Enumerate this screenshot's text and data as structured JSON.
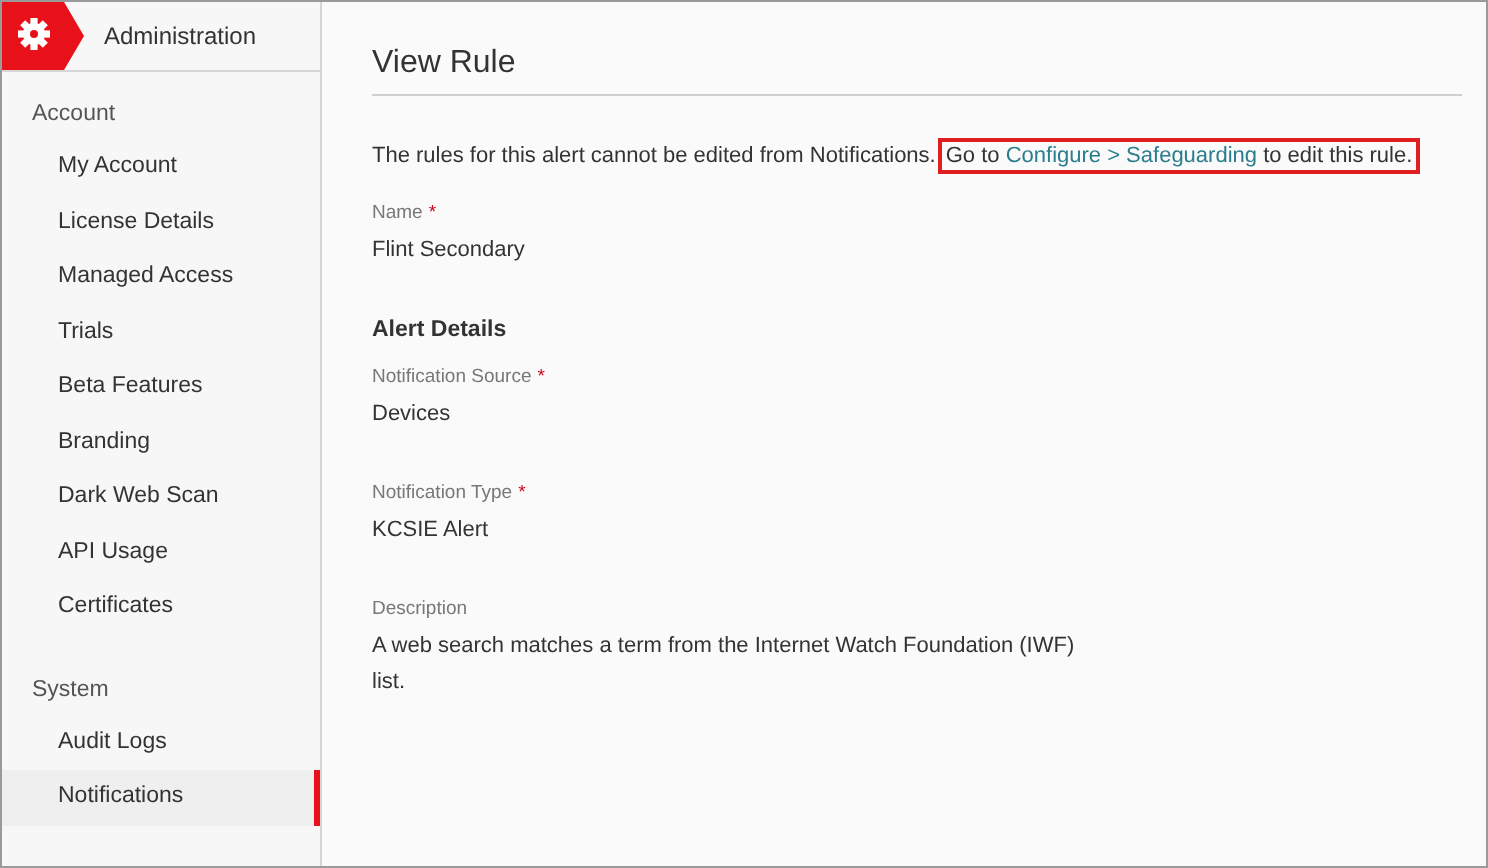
{
  "sidebar": {
    "header": "Administration",
    "groups": [
      {
        "title": "Account",
        "items": [
          {
            "label": "My Account",
            "selected": false
          },
          {
            "label": "License Details",
            "selected": false
          },
          {
            "label": "Managed Access",
            "selected": false
          },
          {
            "label": "Trials",
            "selected": false
          },
          {
            "label": "Beta Features",
            "selected": false
          },
          {
            "label": "Branding",
            "selected": false
          },
          {
            "label": "Dark Web Scan",
            "selected": false
          },
          {
            "label": "API Usage",
            "selected": false
          },
          {
            "label": "Certificates",
            "selected": false
          }
        ]
      },
      {
        "title": "System",
        "items": [
          {
            "label": "Audit Logs",
            "selected": false
          },
          {
            "label": "Notifications",
            "selected": true
          }
        ]
      }
    ]
  },
  "main": {
    "title": "View Rule",
    "note": "The rules for this alert cannot be edited from Notifications.",
    "callout": {
      "before": "Go to ",
      "link": "Configure > Safeguarding",
      "after": " to edit this rule."
    },
    "items": [
      {
        "kind": "field",
        "label": "Name",
        "required_mark": "*",
        "value": "Flint Secondary"
      },
      {
        "kind": "heading",
        "text": "Alert Details"
      },
      {
        "kind": "field",
        "label": "Notification Source",
        "required_mark": "*",
        "value": "Devices"
      },
      {
        "kind": "field",
        "label": "Notification Type",
        "required_mark": "*",
        "value": "KCSIE Alert"
      },
      {
        "kind": "field",
        "label": "Description",
        "value": "A web search matches a term from the Internet Watch Foundation (IWF) list."
      }
    ]
  }
}
